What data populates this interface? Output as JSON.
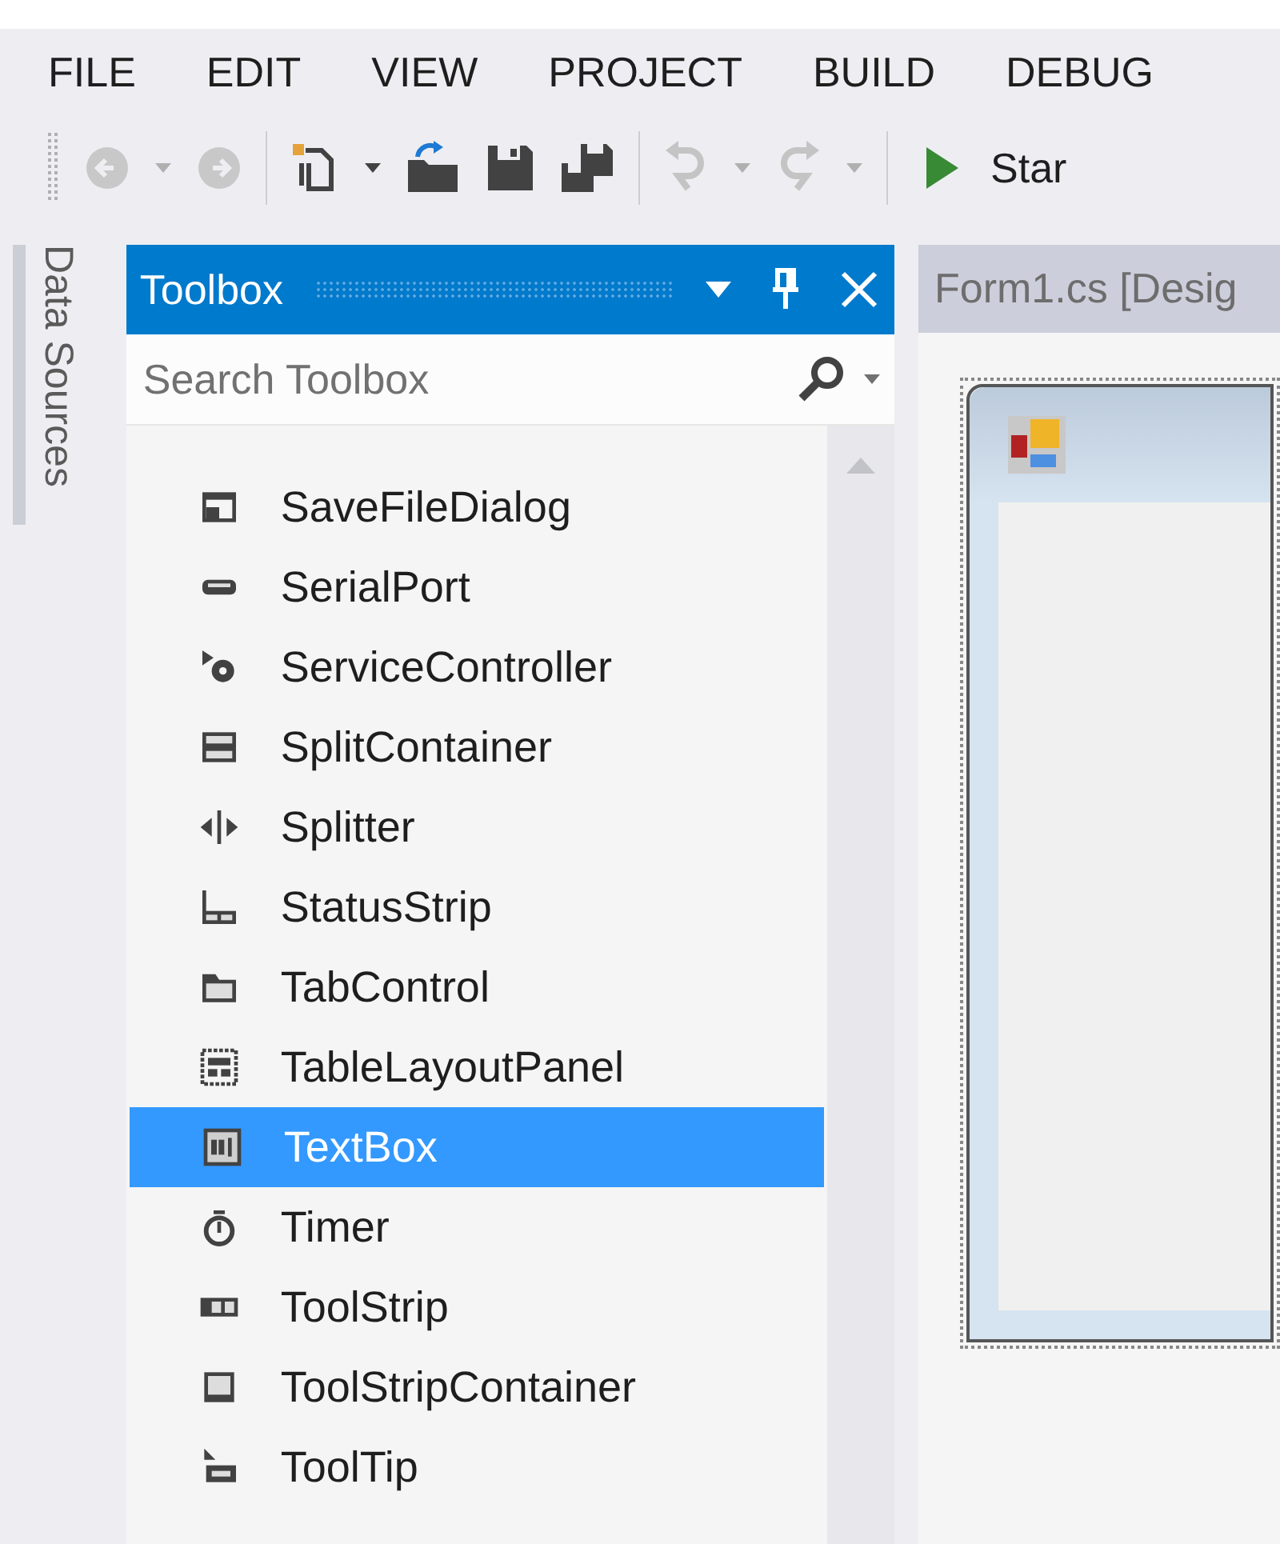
{
  "menu": [
    "FILE",
    "EDIT",
    "VIEW",
    "PROJECT",
    "BUILD",
    "DEBUG"
  ],
  "toolbar": {
    "start_label": "Star"
  },
  "side_tab": "Data Sources",
  "toolbox": {
    "title": "Toolbox",
    "search": {
      "placeholder": "Search Toolbox"
    },
    "items": [
      {
        "label": "SaveFileDialog",
        "selected": false
      },
      {
        "label": "SerialPort",
        "selected": false
      },
      {
        "label": "ServiceController",
        "selected": false
      },
      {
        "label": "SplitContainer",
        "selected": false
      },
      {
        "label": "Splitter",
        "selected": false
      },
      {
        "label": "StatusStrip",
        "selected": false
      },
      {
        "label": "TabControl",
        "selected": false
      },
      {
        "label": "TableLayoutPanel",
        "selected": false
      },
      {
        "label": "TextBox",
        "selected": true
      },
      {
        "label": "Timer",
        "selected": false
      },
      {
        "label": "ToolStrip",
        "selected": false
      },
      {
        "label": "ToolStripContainer",
        "selected": false
      },
      {
        "label": "ToolTip",
        "selected": false
      }
    ]
  },
  "document_tab": {
    "title": "Form1.cs [Desig"
  }
}
